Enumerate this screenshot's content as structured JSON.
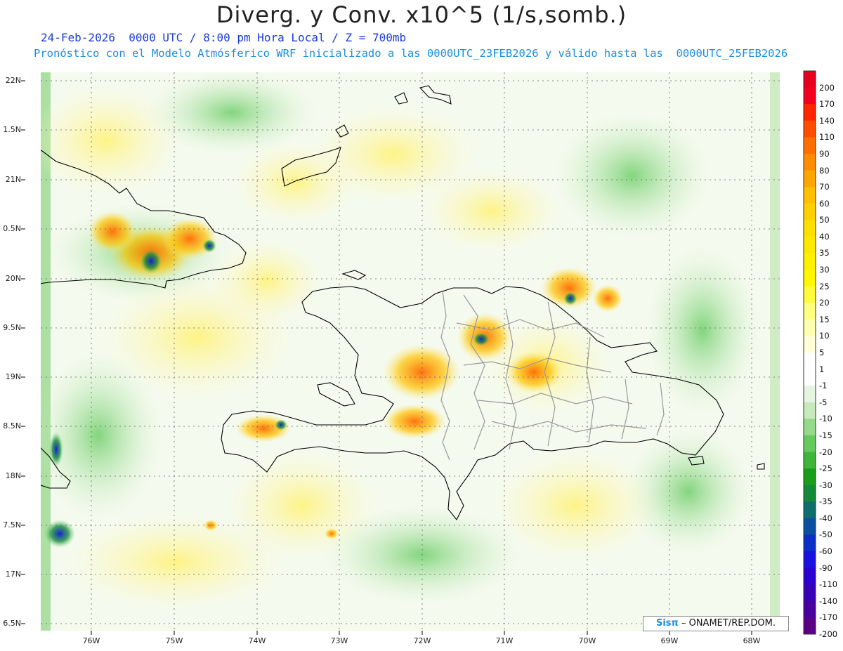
{
  "title": "Diverg. y Conv. x10^5 (1/s,somb.)",
  "subtitle_line1": "24-Feb-2026  0000 UTC / 8:00 pm Hora Local / Z = 700mb",
  "subtitle_line2": "Pronóstico con el Modelo Atmósferico WRF inicializado a las 0000UTC_23FEB2026 y válido hasta las  0000UTC_25FEB2026",
  "lat_labels": [
    "22N",
    "1.5N",
    "21N",
    "0.5N",
    "20N",
    "9.5N",
    "19N",
    "8.5N",
    "18N",
    "7.5N",
    "17N",
    "6.5N"
  ],
  "lon_labels": [
    "76W",
    "75W",
    "74W",
    "73W",
    "72W",
    "71W",
    "70W",
    "69W",
    "68W"
  ],
  "colorbar": {
    "labels": [
      "200",
      "170",
      "140",
      "110",
      "90",
      "80",
      "70",
      "60",
      "50",
      "40",
      "35",
      "30",
      "25",
      "20",
      "15",
      "10",
      "5",
      "1",
      "-1",
      "-5",
      "-10",
      "-15",
      "-20",
      "-25",
      "-30",
      "-35",
      "-40",
      "-50",
      "-60",
      "-90",
      "-110",
      "-140",
      "-170",
      "-200"
    ],
    "colors": [
      "#e5001f",
      "#f4001f",
      "#ff2600",
      "#ff4d00",
      "#ff6f00",
      "#ff8c00",
      "#ffa500",
      "#ffbf00",
      "#ffd000",
      "#ffdf00",
      "#ffe800",
      "#fff000",
      "#fff600",
      "#fffb3c",
      "#ffff80",
      "#ffffb0",
      "#ffffd8",
      "#ffffff",
      "#ffffff",
      "#e6f5e0",
      "#c6eabb",
      "#95d98a",
      "#66c95e",
      "#3fb53a",
      "#1a9d1a",
      "#138a3a",
      "#0e6e6e",
      "#0b4fa0",
      "#0b2fc6",
      "#1a10e0",
      "#2c00d0",
      "#3a00b8",
      "#4a009e",
      "#5a0085"
    ]
  },
  "credit": {
    "logo": "Sisπ",
    "text": "– ONAMET/REP.DOM."
  }
}
